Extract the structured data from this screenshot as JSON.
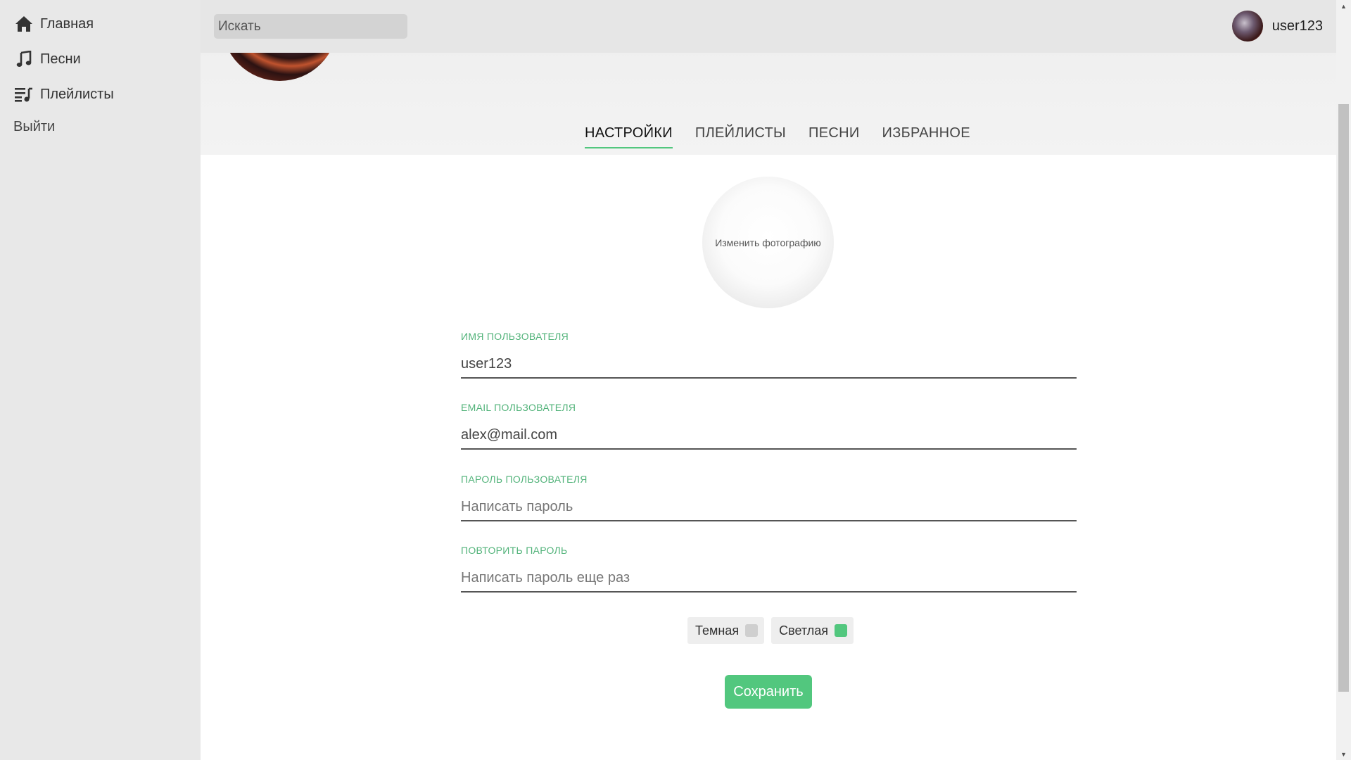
{
  "sidebar": {
    "items": [
      {
        "label": "Главная",
        "icon": "home-icon"
      },
      {
        "label": "Песни",
        "icon": "music-note-icon"
      },
      {
        "label": "Плейлисты",
        "icon": "playlist-icon"
      }
    ],
    "logout_label": "Выйти"
  },
  "header": {
    "search_placeholder": "Искать",
    "username": "user123"
  },
  "tabs": [
    {
      "label": "НАСТРОЙКИ",
      "active": true
    },
    {
      "label": "ПЛЕЙЛИСТЫ",
      "active": false
    },
    {
      "label": "ПЕСНИ",
      "active": false
    },
    {
      "label": "ИЗБРАННОЕ",
      "active": false
    }
  ],
  "settings": {
    "change_photo_label": "Изменить фотографию",
    "fields": [
      {
        "label": "ИМЯ ПОЛЬЗОВАТЕЛЯ",
        "value": "user123",
        "placeholder": ""
      },
      {
        "label": "EMAIL ПОЛЬЗОВАТЕЛЯ",
        "value": "alex@mail.com",
        "placeholder": ""
      },
      {
        "label": "ПАРОЛЬ ПОЛЬЗОВАТЕЛЯ",
        "value": "",
        "placeholder": "Написать пароль"
      },
      {
        "label": "ПОВТОРИТЬ ПАРОЛЬ",
        "value": "",
        "placeholder": "Написать пароль еще раз"
      }
    ],
    "themes": [
      {
        "label": "Темная",
        "checked": false
      },
      {
        "label": "Светлая",
        "checked": true
      }
    ],
    "save_label": "Сохранить"
  },
  "colors": {
    "accent": "#52c77e",
    "sidebar_bg": "#e8e8e8",
    "label_green": "#52b37a"
  }
}
